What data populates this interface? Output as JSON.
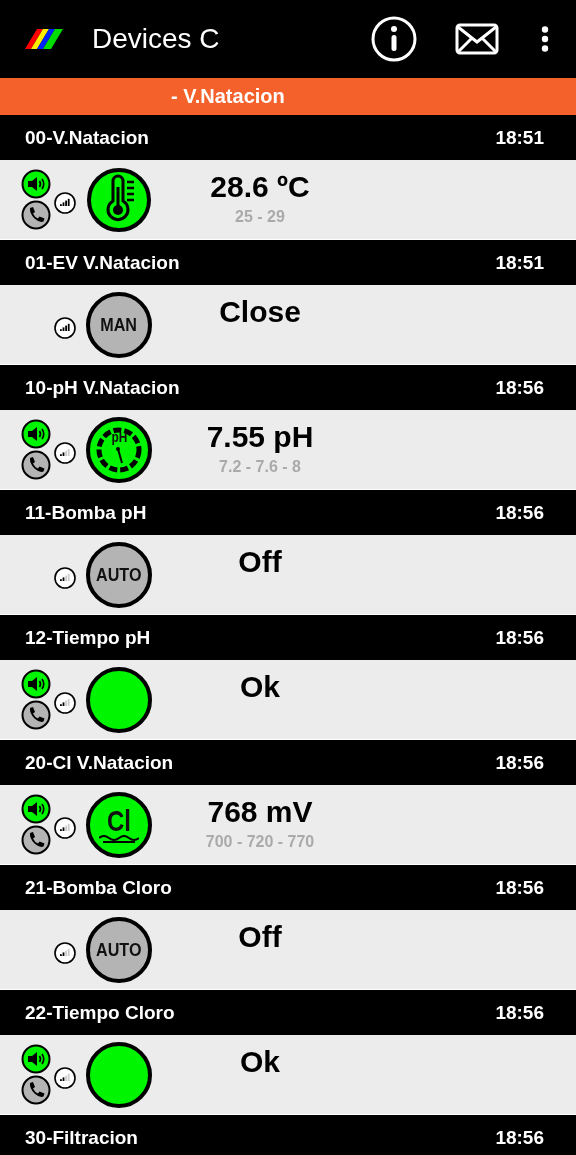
{
  "app_bar": {
    "title": "Devices C"
  },
  "group": {
    "title": "- V.Natacion"
  },
  "devices": [
    {
      "name": "00-V.Natacion",
      "time": "18:51",
      "alerts": {
        "sound": true,
        "call": false
      },
      "strong_signal": true,
      "icon": {
        "kind": "thermometer",
        "active": true
      },
      "value": "28.6 ºC",
      "range": "25 - 29"
    },
    {
      "name": "01-EV V.Natacion",
      "time": "18:51",
      "strong_signal": true,
      "icon": {
        "kind": "mode",
        "label": "MAN",
        "active": false
      },
      "value": "Close"
    },
    {
      "name": "10-pH V.Natacion",
      "time": "18:56",
      "alerts": {
        "sound": true,
        "call": false
      },
      "strong_signal": false,
      "icon": {
        "kind": "ph",
        "label": "pH",
        "active": true
      },
      "value": "7.55 pH",
      "range": "7.2 - 7.6 - 8"
    },
    {
      "name": "11-Bomba pH",
      "time": "18:56",
      "strong_signal": false,
      "icon": {
        "kind": "mode",
        "label": "AUTO",
        "active": false
      },
      "value": "Off"
    },
    {
      "name": "12-Tiempo pH",
      "time": "18:56",
      "alerts": {
        "sound": true,
        "call": false
      },
      "strong_signal": false,
      "icon": {
        "kind": "plain",
        "active": true
      },
      "value": "Ok"
    },
    {
      "name": "20-Cl V.Natacion",
      "time": "18:56",
      "alerts": {
        "sound": true,
        "call": false
      },
      "strong_signal": false,
      "icon": {
        "kind": "chlorine",
        "label": "Cl",
        "active": true
      },
      "value": "768 mV",
      "range": "700 - 720 - 770"
    },
    {
      "name": "21-Bomba Cloro",
      "time": "18:56",
      "strong_signal": false,
      "icon": {
        "kind": "mode",
        "label": "AUTO",
        "active": false
      },
      "value": "Off"
    },
    {
      "name": "22-Tiempo Cloro",
      "time": "18:56",
      "alerts": {
        "sound": true,
        "call": false
      },
      "strong_signal": false,
      "icon": {
        "kind": "plain",
        "active": true
      },
      "value": "Ok"
    },
    {
      "name": "30-Filtracion",
      "time": "18:56"
    }
  ]
}
